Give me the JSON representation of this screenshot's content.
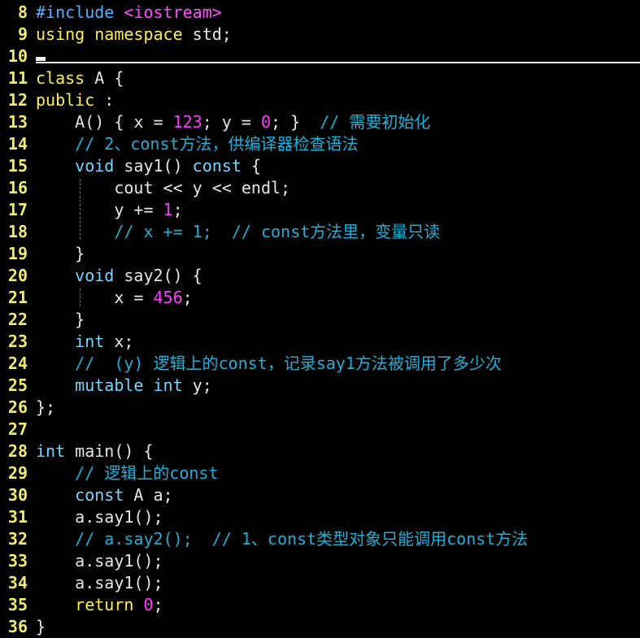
{
  "lines": [
    {
      "n": "8",
      "code": [
        [
          "pp",
          "#include"
        ],
        [
          "tx",
          " "
        ],
        [
          "inc",
          "<iostream>"
        ]
      ]
    },
    {
      "n": "9",
      "code": [
        [
          "kw",
          "using"
        ],
        [
          "tx",
          " "
        ],
        [
          "kw",
          "namespace"
        ],
        [
          "tx",
          " std;"
        ]
      ]
    },
    {
      "n": "10",
      "code": []
    },
    {
      "n": "11",
      "code": [
        [
          "kw",
          "class"
        ],
        [
          "tx",
          " A {"
        ]
      ]
    },
    {
      "n": "12",
      "code": [
        [
          "kw",
          "public"
        ],
        [
          "tx",
          " :"
        ]
      ]
    },
    {
      "n": "13",
      "code": [
        [
          "tx",
          "    A() { x = "
        ],
        [
          "num",
          "123"
        ],
        [
          "tx",
          "; y = "
        ],
        [
          "num",
          "0"
        ],
        [
          "tx",
          "; }  "
        ],
        [
          "cm",
          "// 需要初始化"
        ]
      ]
    },
    {
      "n": "14",
      "code": [
        [
          "cm",
          "    // 2、const方法，供编译器检查语法"
        ]
      ]
    },
    {
      "n": "15",
      "code": [
        [
          "tx",
          "    "
        ],
        [
          "ty",
          "void"
        ],
        [
          "tx",
          " say1() "
        ],
        [
          "ty",
          "const"
        ],
        [
          "tx",
          " {"
        ]
      ]
    },
    {
      "n": "16",
      "code": [
        [
          "tx",
          "        cout << y << endl;"
        ]
      ]
    },
    {
      "n": "17",
      "code": [
        [
          "tx",
          "        y += "
        ],
        [
          "num",
          "1"
        ],
        [
          "tx",
          ";"
        ]
      ]
    },
    {
      "n": "18",
      "code": [
        [
          "cm",
          "        // x += 1;  // const方法里，变量只读"
        ]
      ]
    },
    {
      "n": "19",
      "code": [
        [
          "tx",
          "    }"
        ]
      ]
    },
    {
      "n": "20",
      "code": [
        [
          "tx",
          "    "
        ],
        [
          "ty",
          "void"
        ],
        [
          "tx",
          " say2() {"
        ]
      ]
    },
    {
      "n": "21",
      "code": [
        [
          "tx",
          "        x = "
        ],
        [
          "num",
          "456"
        ],
        [
          "tx",
          ";"
        ]
      ]
    },
    {
      "n": "22",
      "code": [
        [
          "tx",
          "    }"
        ]
      ]
    },
    {
      "n": "23",
      "code": [
        [
          "tx",
          "    "
        ],
        [
          "ty",
          "int"
        ],
        [
          "tx",
          " x;"
        ]
      ]
    },
    {
      "n": "24",
      "code": [
        [
          "cm",
          "    //  (y) 逻辑上的const，记录say1方法被调用了多少次"
        ]
      ]
    },
    {
      "n": "25",
      "code": [
        [
          "tx",
          "    "
        ],
        [
          "ty",
          "mutable"
        ],
        [
          "tx",
          " "
        ],
        [
          "ty",
          "int"
        ],
        [
          "tx",
          " y;"
        ]
      ]
    },
    {
      "n": "26",
      "code": [
        [
          "tx",
          "};"
        ]
      ]
    },
    {
      "n": "27",
      "code": []
    },
    {
      "n": "28",
      "code": [
        [
          "ty",
          "int"
        ],
        [
          "tx",
          " main() {"
        ]
      ]
    },
    {
      "n": "29",
      "code": [
        [
          "cm",
          "    // 逻辑上的const"
        ]
      ]
    },
    {
      "n": "30",
      "code": [
        [
          "tx",
          "    "
        ],
        [
          "ty",
          "const"
        ],
        [
          "tx",
          " A a;"
        ]
      ]
    },
    {
      "n": "31",
      "code": [
        [
          "tx",
          "    a.say1();"
        ]
      ]
    },
    {
      "n": "32",
      "code": [
        [
          "cm",
          "    // a.say2();  // 1、const类型对象只能调用const方法"
        ]
      ]
    },
    {
      "n": "33",
      "code": [
        [
          "tx",
          "    a.say1();"
        ]
      ]
    },
    {
      "n": "34",
      "code": [
        [
          "tx",
          "    a.say1();"
        ]
      ]
    },
    {
      "n": "35",
      "code": [
        [
          "tx",
          "    "
        ],
        [
          "kw",
          "return"
        ],
        [
          "tx",
          " "
        ],
        [
          "num",
          "0"
        ],
        [
          "tx",
          ";"
        ]
      ]
    },
    {
      "n": "36",
      "code": [
        [
          "tx",
          "}"
        ]
      ]
    }
  ],
  "colors": {
    "keyword": "#ffef5c",
    "type": "#78d5ff",
    "preprocessor": "#4fb0ff",
    "include_path": "#ff4fff",
    "number": "#ff3cff",
    "comment": "#1fb0d8",
    "line_number": "#f0ec71",
    "gutter": "#6b6b6b"
  }
}
